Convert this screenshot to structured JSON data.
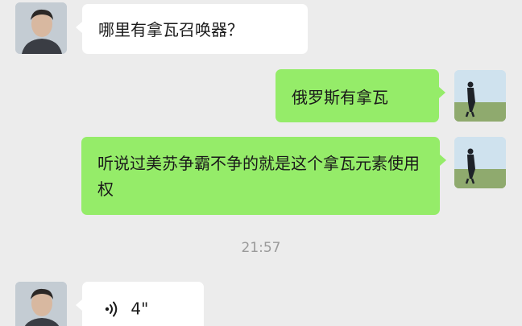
{
  "messages": [
    {
      "side": "left",
      "text": "哪里有拿瓦召唤器？"
    },
    {
      "side": "right",
      "text": "俄罗斯有拿瓦"
    },
    {
      "side": "right",
      "text": "听说过美苏争霸不争的就是这个拿瓦元素使用权"
    }
  ],
  "timestamp": "21:57",
  "voice_message": {
    "icon": "voice-waves-icon",
    "duration": "4\""
  },
  "colors": {
    "background": "#ececec",
    "incoming_bubble": "#ffffff",
    "outgoing_bubble": "#95ec69",
    "timestamp_text": "#9a9a9a"
  }
}
